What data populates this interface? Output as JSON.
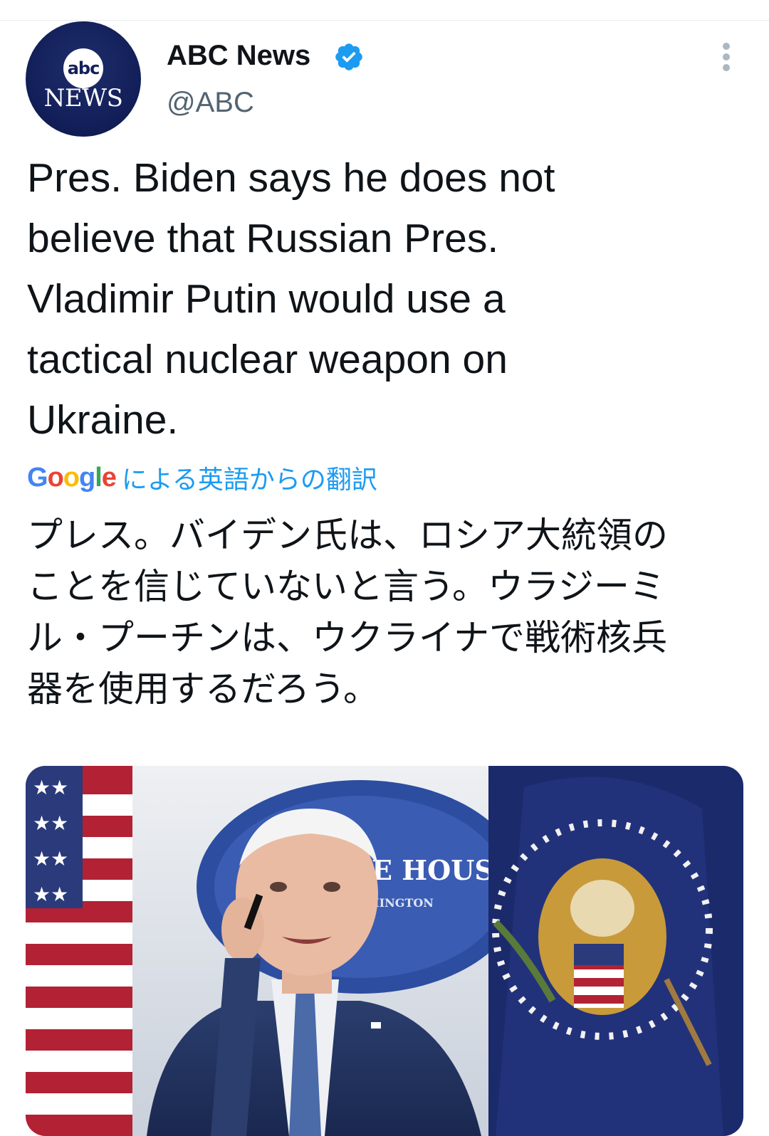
{
  "account": {
    "avatar_abc": "abc",
    "avatar_news": "NEWS",
    "display_name": "ABC News",
    "handle": "@ABC",
    "verified_icon": "verified-badge-icon",
    "more_icon": "more-vertical-icon"
  },
  "tweet": {
    "text": "Pres. Biden says he does not\nbelieve that Russian Pres.\nVladimir Putin would use a\ntactical nuclear weapon on\nUkraine."
  },
  "translation": {
    "provider": "Google",
    "label": "による英語からの翻訳",
    "text": "プレス。バイデン氏は、ロシア大統領の\nことを信じていないと言う。ウラジーミ\nル・プーチンは、ウクライナで戦術核兵\n器を使用するだろう。"
  },
  "media": {
    "sign_text": "ITE HOUSE",
    "sign_subtext": "SHINGTON"
  },
  "colors": {
    "accent": "#1d9bf0",
    "text_primary": "#0f1419",
    "text_secondary": "#536471",
    "abc_navy": "#13205a"
  }
}
